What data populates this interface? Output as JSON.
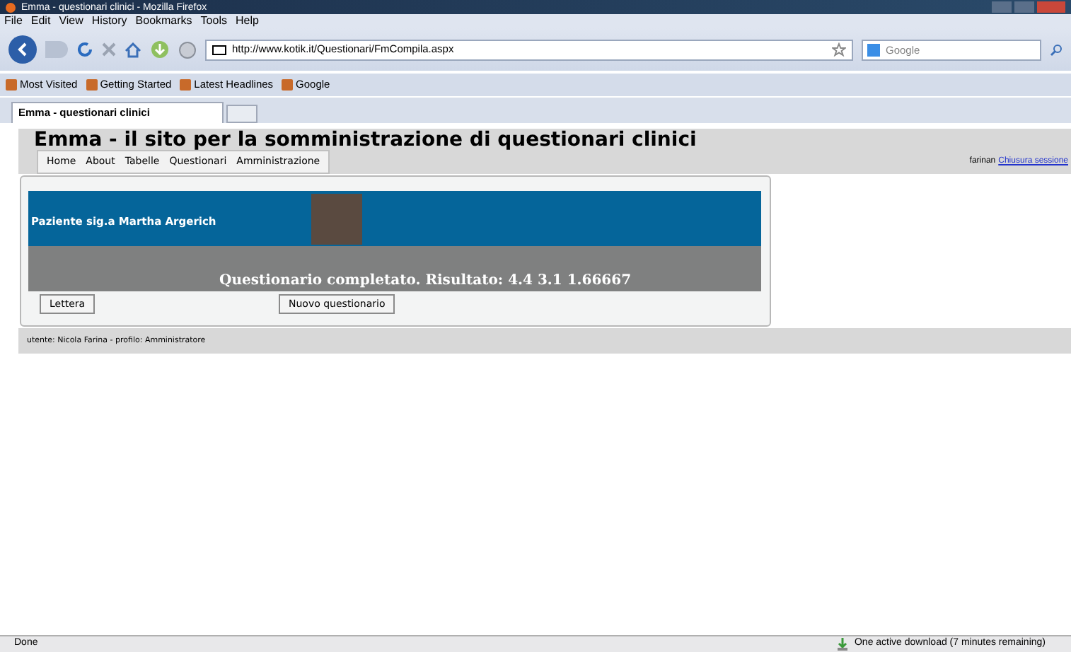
{
  "window": {
    "title": "Emma - questionari clinici - Mozilla Firefox"
  },
  "menu_bar": [
    "File",
    "Edit",
    "View",
    "History",
    "Bookmarks",
    "Tools",
    "Help"
  ],
  "address_bar": {
    "value": "http://www.kotik.it/Questionari/FmCompila.aspx"
  },
  "search": {
    "placeholder": "Google"
  },
  "bookmarks": [
    "Most Visited",
    "Getting Started",
    "Latest Headlines",
    "Google"
  ],
  "tabs": [
    {
      "label": "Emma - questionari clinici",
      "selected": true
    }
  ],
  "page": {
    "title": "Emma - il sito per la somministrazione di questionari clinici",
    "nav": [
      "Home",
      "About",
      "Tabelle",
      "Questionari",
      "Amministrazione"
    ],
    "user": "farinan",
    "logout": "Chiusura sessione",
    "patient": "Paziente sig.a Martha Argerich",
    "result": "Questionario completato. Risultato: 4.4 3.1 1.66667",
    "buttons": [
      "Lettera",
      "Nuovo questionario"
    ],
    "footer": "utente: Nicola Farina - profilo: Amministratore"
  },
  "status_bar": {
    "text": "Done",
    "download": "One active download (7 minutes remaining)"
  }
}
